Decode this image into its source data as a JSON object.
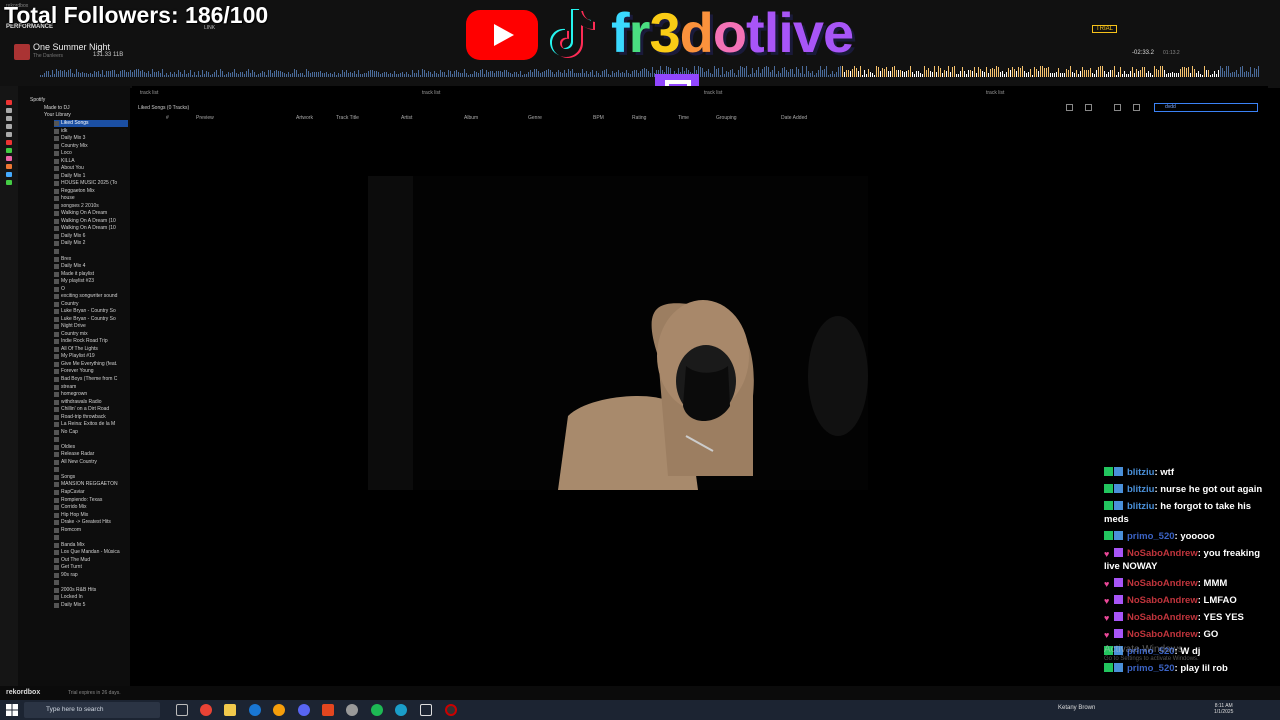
{
  "window_title": "rekordbox",
  "deck": {
    "mode": "PERFORMANCE",
    "link": "LINK",
    "track_title": "One Summer Night",
    "track_artist": "The Danleers",
    "bpm_key": "131.33 11B",
    "trial": "TRIAL",
    "time_remaining": "-02:33.2",
    "time_total": "01:13.2"
  },
  "overlay": {
    "followers": "Total Followers: 186/100",
    "brand_letters": [
      "f",
      "r",
      "3",
      "d",
      "o",
      "tlive"
    ],
    "colors": {
      "youtube": "#ff0000",
      "twitch": "#9146ff",
      "highlight": "#1b4fa3"
    }
  },
  "sidebar": {
    "root": "Spotify",
    "made_for": "Made to DJ",
    "library": "Your Library",
    "playlists": [
      "Liked Songs",
      "idk",
      "Daily Mix 3",
      "Country Mix",
      "Loco",
      "KILLA",
      "About You",
      "Daily Mix 1",
      "HOUSE MUSIC 2025 (To",
      "Reggaeton Mix",
      "house",
      "songses 2 2010s",
      "Walking On A Dream",
      "Walking On A Dream (10",
      "Walking On A Dream (10",
      "Daily Mix 6",
      "Daily Mix 2",
      "",
      "Brex",
      "Daily Mix 4",
      "Made it playlist",
      "My playlist #23",
      "O",
      "exciting songwriter sound",
      "Country",
      "Luke Bryan - Country So",
      "Luke Bryan - Country So",
      "Night Drive",
      "Country mix",
      "Indie Rock Road Trip",
      "All Of The Lights",
      "My Playlist #19",
      "Give Me Everything (feat.",
      "Forever Young",
      "Bad Boys (Theme from C",
      "stream",
      "homegrown",
      "withdrawals Radio",
      "Chillin' on a Dirt Road",
      "Road-trip throwback",
      "La Reina: Éxitos de la M",
      "No Cap",
      "",
      "Oldies",
      "Release Radar",
      "All New Country",
      "",
      "Songs",
      "MANSION REGGAETON",
      "RapCaviar",
      "Rompiendo: Texas",
      "Corrido Mix",
      "Hip Hop Mix",
      "Drake -> Greatest Hits",
      "Romcom",
      "",
      "Banda Mix",
      "Los Que Mandan - Música",
      "Out The Mud",
      "Get Turnt",
      "90s rap",
      "",
      "2000s R&B Hits",
      "Locked In",
      "Daily Mix 5"
    ]
  },
  "browser": {
    "tabs": [
      "track list",
      "track list",
      "track list",
      "track list"
    ],
    "breadcrumb": "Liked Songs (0 Tracks)",
    "columns": [
      "#",
      "Preview",
      "Artwork",
      "Track Title",
      "Artist",
      "Album",
      "Genre",
      "BPM",
      "Rating",
      "Time",
      "Grouping",
      "Date Added"
    ],
    "search_value": "dvdd"
  },
  "chat": [
    {
      "user": "blitziu",
      "user_color": "#4a90d9",
      "badge": "green",
      "text": "wtf"
    },
    {
      "user": "blitziu",
      "user_color": "#4a90d9",
      "badge": "green",
      "text": "nurse he got out again"
    },
    {
      "user": "blitziu",
      "user_color": "#4a90d9",
      "badge": "green",
      "text": "he forgot to take his meds"
    },
    {
      "user": "primo_520",
      "user_color": "#3b63c4",
      "badge": "green",
      "text": "yooooo"
    },
    {
      "user": "NoSaboAndrew",
      "user_color": "#c0343c",
      "badge": "heart",
      "text": "you freaking live NOWAY"
    },
    {
      "user": "NoSaboAndrew",
      "user_color": "#c0343c",
      "badge": "heart",
      "text": "MMM"
    },
    {
      "user": "NoSaboAndrew",
      "user_color": "#c0343c",
      "badge": "heart",
      "text": "LMFAO"
    },
    {
      "user": "NoSaboAndrew",
      "user_color": "#c0343c",
      "badge": "heart",
      "text": "YES YES"
    },
    {
      "user": "NoSaboAndrew",
      "user_color": "#c0343c",
      "badge": "heart",
      "text": "GO"
    },
    {
      "user": "primo_520",
      "user_color": "#3b63c4",
      "badge": "green",
      "text": "W dj"
    },
    {
      "user": "primo_520",
      "user_color": "#3b63c4",
      "badge": "green",
      "text": "play lil rob"
    }
  ],
  "watermark": {
    "title": "Activate Windows",
    "sub": "Go to Settings to activate Windows."
  },
  "footer": {
    "logo": "rekordbox",
    "trial_text": "Trial expires in 26 days."
  },
  "taskbar": {
    "search_placeholder": "Type here to search",
    "user": "Ketany Brown",
    "time": "8:11 AM",
    "date": "1/1/2025"
  }
}
